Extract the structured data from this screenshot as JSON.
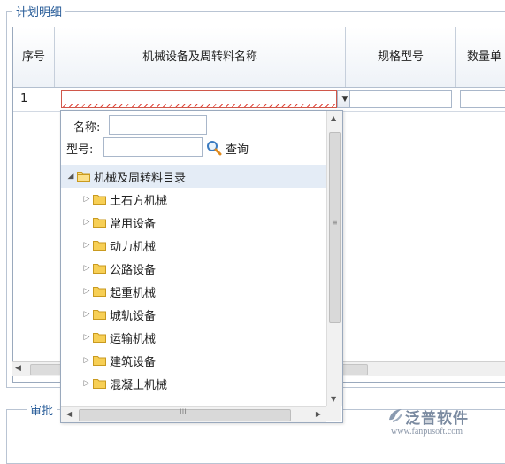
{
  "section_title": "计划明细",
  "approval_title": "审批",
  "grid": {
    "columns": [
      "序号",
      "机械设备及周转料名称",
      "规格型号",
      "数量单"
    ],
    "row_no": "1"
  },
  "search": {
    "name_label": "名称:",
    "model_label": "型号:",
    "query_label": "查询"
  },
  "tree": {
    "root": "机械及周转料目录",
    "children": [
      "土石方机械",
      "常用设备",
      "动力机械",
      "公路设备",
      "起重机械",
      "城轨设备",
      "运输机械",
      "建筑设备",
      "混凝土机械"
    ]
  },
  "watermark": {
    "name": "泛普软件",
    "url": "www.fanpusoft.com"
  },
  "colors": {
    "border": "#9aa9bd",
    "folder": "#f3c64f",
    "legend_text": "#2a5e9a",
    "error_underline": "#e0493d"
  }
}
